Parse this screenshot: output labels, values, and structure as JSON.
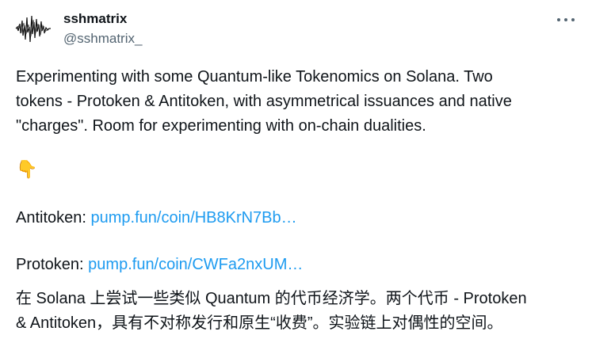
{
  "author": {
    "display_name": "sshmatrix",
    "handle": "@sshmatrix_"
  },
  "menu": {
    "more_icon": "more-horizontal-icon"
  },
  "post": {
    "lines": [
      "Experimenting with some Quantum-like Tokenomics on Solana. Two",
      "tokens - Protoken & Antitoken, with asymmetrical issuances and native",
      "\"charges\". Room for experimenting with on-chain dualities."
    ],
    "emoji": "👇",
    "antitoken": {
      "label": "Antitoken: ",
      "link": "pump.fun/coin/HB8KrN7Bb…"
    },
    "protoken": {
      "label": "Protoken: ",
      "link": "pump.fun/coin/CWFa2nxUM…"
    },
    "translation_lines": [
      "在 Solana 上尝试一些类似 Quantum 的代币经济学。两个代币 - Protoken",
      "& Antitoken，具有不对称发行和原生“收费”。实验链上对偶性的空间。"
    ]
  },
  "colors": {
    "text": "#0f1419",
    "secondary": "#536471",
    "link": "#1d9bf0"
  }
}
